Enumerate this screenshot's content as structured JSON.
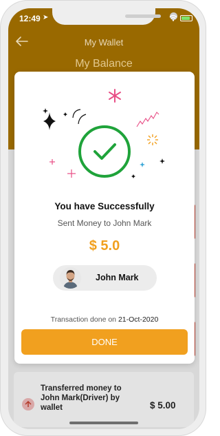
{
  "status_bar": {
    "time": "12:49"
  },
  "header": {
    "title": "My Wallet",
    "balance_title": "My Balance"
  },
  "modal": {
    "title": "You have Successfully",
    "subtitle": "Sent Money to John Mark",
    "amount": "$ 5.0",
    "recipient_name": "John Mark",
    "transaction_prefix": "Transaction done on",
    "transaction_date": "21-Oct-2020",
    "done_label": "DONE"
  },
  "transaction": {
    "text": "Transferred money to John Mark(Driver) by wallet",
    "amount": "$ 5.00"
  },
  "colors": {
    "accent": "#f1a01f",
    "header": "#996900",
    "success": "#1fa33a"
  }
}
